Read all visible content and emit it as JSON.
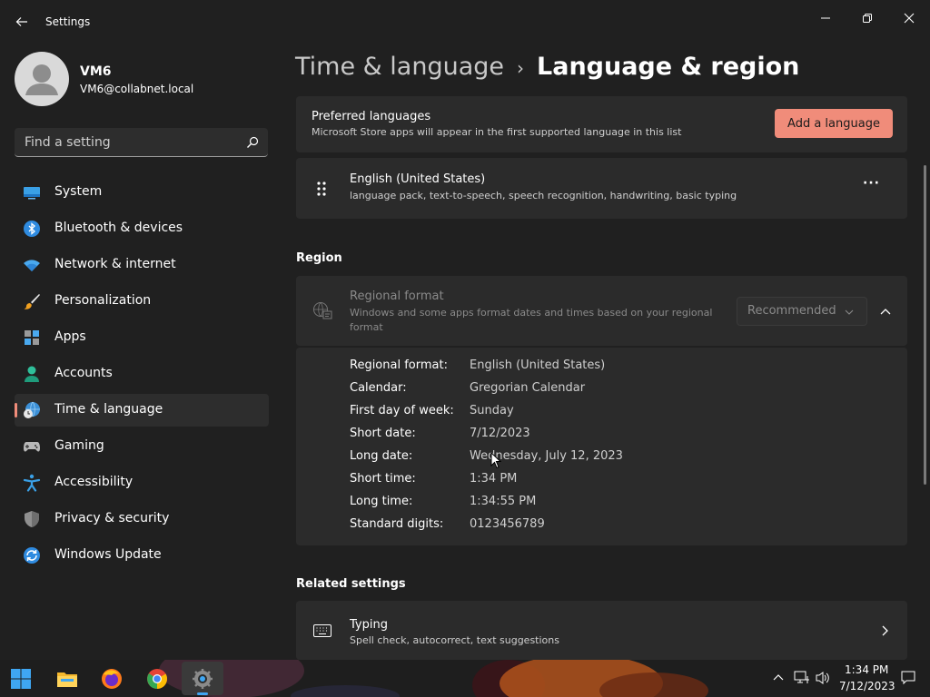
{
  "window": {
    "title": "Settings"
  },
  "user": {
    "name": "VM6",
    "email": "VM6@collabnet.local"
  },
  "search": {
    "placeholder": "Find a setting"
  },
  "nav": {
    "items": [
      {
        "label": "System",
        "icon": "monitor-icon",
        "active": false
      },
      {
        "label": "Bluetooth & devices",
        "icon": "bluetooth-icon",
        "active": false
      },
      {
        "label": "Network & internet",
        "icon": "wifi-icon",
        "active": false
      },
      {
        "label": "Personalization",
        "icon": "brush-icon",
        "active": false
      },
      {
        "label": "Apps",
        "icon": "apps-icon",
        "active": false
      },
      {
        "label": "Accounts",
        "icon": "account-icon",
        "active": false
      },
      {
        "label": "Time & language",
        "icon": "clock-globe-icon",
        "active": true
      },
      {
        "label": "Gaming",
        "icon": "gamepad-icon",
        "active": false
      },
      {
        "label": "Accessibility",
        "icon": "accessibility-icon",
        "active": false
      },
      {
        "label": "Privacy & security",
        "icon": "shield-icon",
        "active": false
      },
      {
        "label": "Windows Update",
        "icon": "update-icon",
        "active": false
      }
    ]
  },
  "breadcrumb": {
    "parent": "Time & language",
    "separator": "›",
    "current": "Language & region"
  },
  "preferred": {
    "title": "Preferred languages",
    "description": "Microsoft Store apps will appear in the first supported language in this list",
    "add_button": "Add a language"
  },
  "language": {
    "name": "English (United States)",
    "features": "language pack, text-to-speech, speech recognition, handwriting, basic typing",
    "more": "···"
  },
  "region": {
    "heading": "Region",
    "format_title": "Regional format",
    "format_desc_line1": "Windows and some apps format dates and times based on your regional",
    "format_desc_line2": "format",
    "dropdown_value": "Recommended",
    "rows": [
      {
        "label": "Regional format:",
        "value": "English (United States)"
      },
      {
        "label": "Calendar:",
        "value": "Gregorian Calendar"
      },
      {
        "label": "First day of week:",
        "value": "Sunday"
      },
      {
        "label": "Short date:",
        "value": "7/12/2023"
      },
      {
        "label": "Long date:",
        "value": "Wednesday, July 12, 2023"
      },
      {
        "label": "Short time:",
        "value": "1:34 PM"
      },
      {
        "label": "Long time:",
        "value": "1:34:55 PM"
      },
      {
        "label": "Standard digits:",
        "value": "0123456789"
      }
    ]
  },
  "related": {
    "heading": "Related settings",
    "typing_title": "Typing",
    "typing_desc": "Spell check, autocorrect, text suggestions"
  },
  "taskbar": {
    "time": "1:34 PM",
    "date": "7/12/2023",
    "apps": [
      "start-icon",
      "file-explorer-icon",
      "firefox-icon",
      "chrome-icon",
      "settings-icon"
    ]
  },
  "colors": {
    "accent": "#f08c7a",
    "background": "#202020",
    "card": "#2b2b2b"
  }
}
